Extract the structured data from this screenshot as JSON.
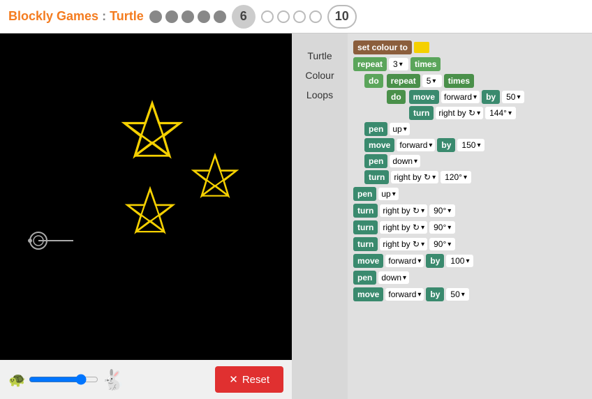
{
  "header": {
    "brand": "Blockly Games",
    "title": "Turtle",
    "current_level": "6",
    "max_level": "10",
    "completed_dots": 5,
    "total_dots": 9
  },
  "sidebar": {
    "items": [
      "Turtle",
      "Colour",
      "Loops"
    ]
  },
  "blocks": {
    "set_colour_label": "set colour to",
    "repeat_label": "repeat",
    "times_label": "times",
    "do_label": "do",
    "move_label": "move",
    "forward_label": "forward",
    "by_label": "by",
    "turn_label": "turn",
    "right_by_label": "right by ↻",
    "pen_label": "pen",
    "up_label": "up",
    "down_label": "down",
    "repeat1_count": "3",
    "repeat2_count": "5",
    "move1_dist": "50",
    "turn1_angle": "144°",
    "move2_dist": "150",
    "turn2_angle": "120°",
    "turn3_angle": "90°",
    "turn4_angle": "90°",
    "turn5_angle": "90°",
    "move3_dist": "100",
    "move4_dist": "50"
  },
  "controls": {
    "reset_label": "Reset",
    "reset_icon": "✕"
  }
}
